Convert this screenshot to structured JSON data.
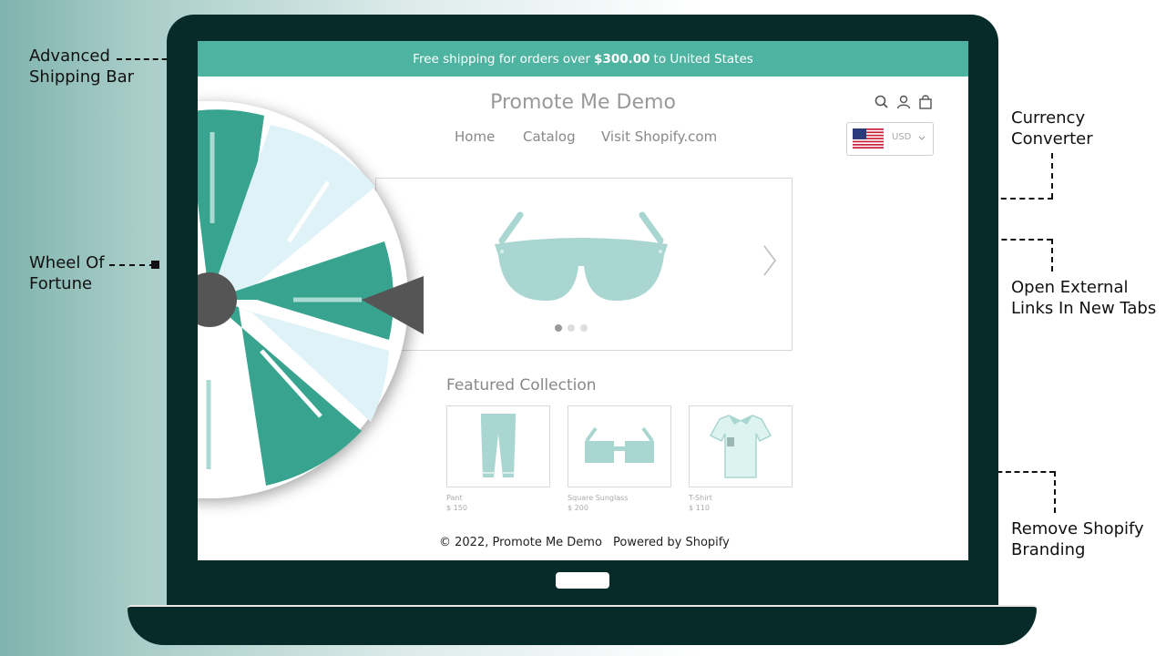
{
  "callouts": {
    "shipping_bar": [
      "Advanced",
      "Shipping Bar"
    ],
    "wheel": [
      "Wheel Of",
      "Fortune"
    ],
    "currency": [
      "Currency",
      "Converter"
    ],
    "external_links": [
      "Open External",
      "Links In New Tabs"
    ],
    "branding": [
      "Remove Shopify",
      "Branding"
    ]
  },
  "store": {
    "shipping_prefix": "Free shipping for orders over",
    "shipping_amount": "$300.00",
    "shipping_suffix": "to United States",
    "title": "Promote Me Demo",
    "nav": [
      "Home",
      "Catalog",
      "Visit Shopify.com"
    ],
    "currency_code": "USD",
    "featured_title": "Featured Collection",
    "products": [
      {
        "name": "Pant",
        "price": "$ 150"
      },
      {
        "name": "Square Sunglass",
        "price": "$ 200"
      },
      {
        "name": "T-Shirt",
        "price": "$ 110"
      }
    ],
    "footer_copyright": "© 2022, Promote Me Demo",
    "footer_powered": "Powered by Shopify"
  },
  "colors": {
    "teal": "#4fb3a1",
    "dark_teal": "#38a38e",
    "light_blue": "#dff2f8",
    "laptop": "#062b28",
    "product_icon": "#a9d6d1"
  },
  "icons": [
    "search-icon",
    "user-icon",
    "bag-icon",
    "chevron-down-icon",
    "chevron-right-icon",
    "us-flag-icon"
  ]
}
